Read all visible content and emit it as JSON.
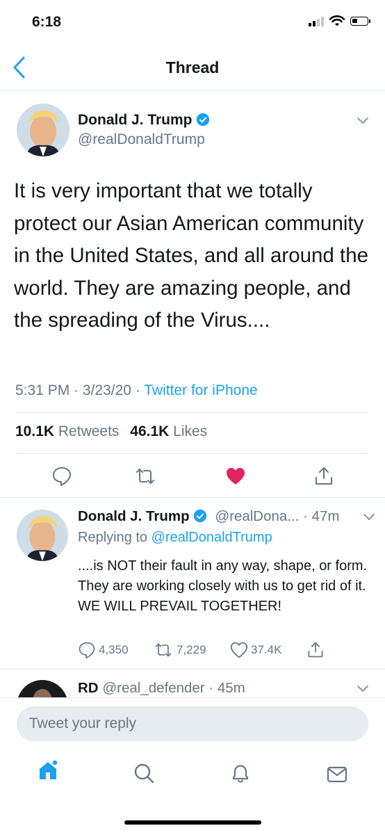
{
  "status_bar": {
    "time": "6:18"
  },
  "nav": {
    "title": "Thread"
  },
  "main_tweet": {
    "name": "Donald J. Trump",
    "handle": "@realDonaldTrump",
    "text": "It is very important that we totally protect our Asian American community in the United States, and all around the world. They are amazing people, and the spreading of the Virus....",
    "time": "5:31 PM",
    "date": "3/23/20",
    "source": "Twitter for iPhone",
    "retweets_count": "10.1K",
    "retweets_label": "Retweets",
    "likes_count": "46.1K",
    "likes_label": "Likes"
  },
  "reply_tweet": {
    "name": "Donald J. Trump",
    "handle": "@realDona...",
    "time": "47m",
    "replying_prefix": "Replying to",
    "replying_handle": "@realDonaldTrump",
    "text": "....is NOT their fault in any way, shape, or form. They are working closely with us to get rid of it. WE WILL PREVAIL TOGETHER!",
    "replies": "4,350",
    "retweets": "7,229",
    "likes": "37.4K"
  },
  "third_tweet": {
    "name": "RD",
    "handle": "@real_defender",
    "time": "45m"
  },
  "compose": {
    "placeholder": "Tweet your reply"
  },
  "colors": {
    "accent": "#1da1f2",
    "like": "#e0245e",
    "muted": "#657786",
    "divider": "#e1e8ed"
  },
  "icons": [
    "back-chevron-icon",
    "verified-icon",
    "reply-icon",
    "retweet-icon",
    "heart-icon",
    "share-icon",
    "home-icon",
    "search-icon",
    "bell-icon",
    "mail-icon"
  ]
}
